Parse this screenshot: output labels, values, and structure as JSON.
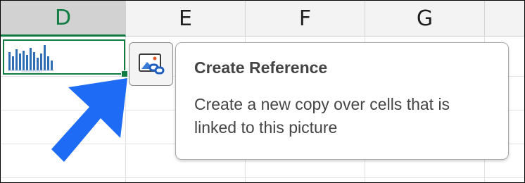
{
  "columns": [
    {
      "label": "D",
      "selected": true
    },
    {
      "label": "E",
      "selected": false
    },
    {
      "label": "F",
      "selected": false
    },
    {
      "label": "G",
      "selected": false
    }
  ],
  "selected_cell": {
    "content": "sparkline-picture-icon"
  },
  "reference_button": {
    "icon": "create-reference-icon"
  },
  "tooltip": {
    "title": "Create Reference",
    "description_line1": "Create a new copy over cells that is",
    "description_line2": "linked to this picture"
  },
  "annotation": {
    "icon": "blue-arrow-icon",
    "color": "#1e6cf5"
  },
  "colors": {
    "selection_green": "#107c41",
    "header_bg": "#f3f3f3",
    "header_selected_bg": "#d2d2d2",
    "sparkline_blue": "#2f6eb5"
  }
}
